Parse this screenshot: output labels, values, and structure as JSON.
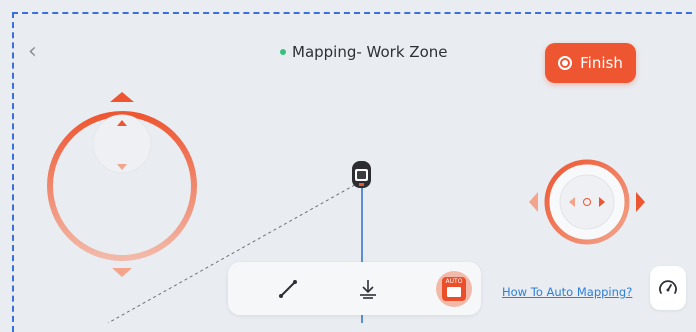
{
  "header": {
    "back_icon": "chevron-left-icon",
    "title": "Mapping- Work Zone",
    "status_color": "#34c27e"
  },
  "finish_button": {
    "label": "Finish",
    "icon": "stop-circle-icon",
    "color": "#ee5631"
  },
  "joystick_left": {
    "axis": "forward-backward",
    "icons": [
      "triangle-up-icon",
      "triangle-down-icon"
    ]
  },
  "joystick_right": {
    "axis": "left-right",
    "icons": [
      "triangle-left-icon",
      "triangle-right-icon"
    ]
  },
  "toolbar": {
    "tools": [
      {
        "name": "draw-line-tool",
        "icon": "line-draw-icon"
      },
      {
        "name": "anchor-tool",
        "icon": "anchor-down-icon"
      }
    ],
    "auto_button": {
      "badge": "AUTO",
      "icon": "auto-map-icon"
    }
  },
  "help_link": {
    "label": "How To Auto Mapping?"
  },
  "speed_button": {
    "icon": "speedometer-icon"
  },
  "accent_color": "#ee5631"
}
